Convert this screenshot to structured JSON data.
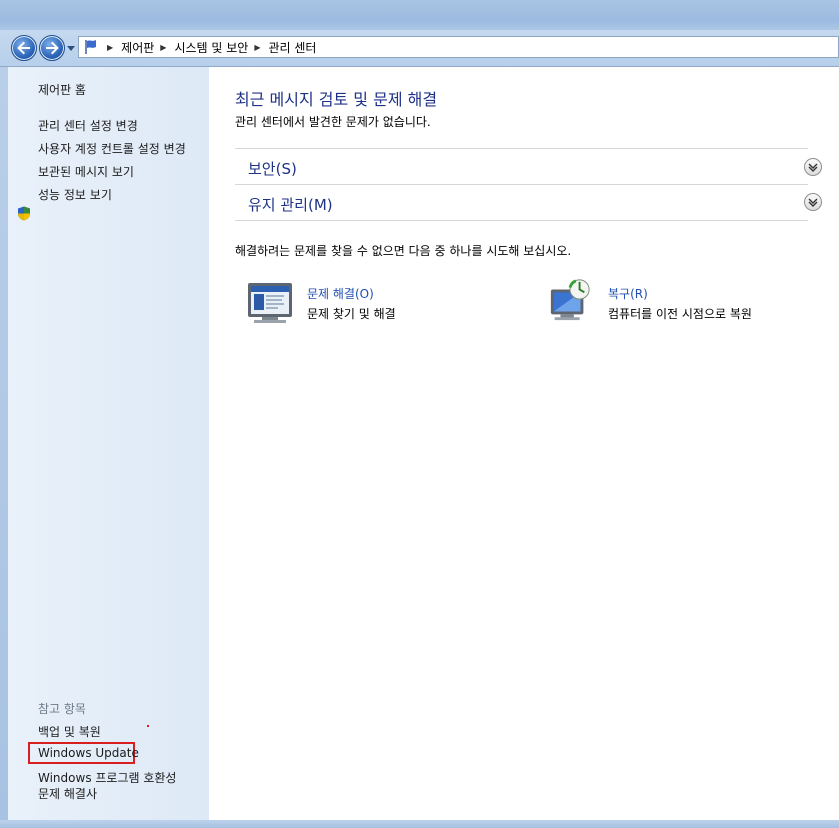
{
  "address_bar": {
    "breadcrumbs": [
      "제어판",
      "시스템 및 보안",
      "관리 센터"
    ]
  },
  "left_pane": {
    "home": "제어판 홈",
    "links": [
      "관리 센터 설정 변경",
      "사용자 계정 컨트롤 설정 변경",
      "보관된 메시지 보기",
      "성능 정보 보기"
    ],
    "see_also_label": "참고 항목",
    "see_also": [
      "백업 및 복원",
      "Windows Update",
      "Windows 프로그램 호환성",
      "문제 해결사"
    ]
  },
  "main": {
    "heading": "최근 메시지 검토 및 문제 해결",
    "subtext": "관리 센터에서 발견한 문제가 없습니다.",
    "sections": [
      {
        "label": "보안(S)"
      },
      {
        "label": "유지 관리(M)"
      }
    ],
    "hint": "해결하려는 문제를 찾을 수 없으면 다음 중 하나를 시도해 보십시오.",
    "tasks": [
      {
        "title": "문제 해결(O)",
        "desc": "문제 찾기 및 해결",
        "icon": "troubleshoot-icon"
      },
      {
        "title": "복구(R)",
        "desc": "컴퓨터를 이전 시점으로 복원",
        "icon": "recovery-icon"
      }
    ]
  },
  "colors": {
    "link": "#1f4fb0",
    "heading": "#1e3287",
    "highlight_box": "#d81e1e"
  }
}
